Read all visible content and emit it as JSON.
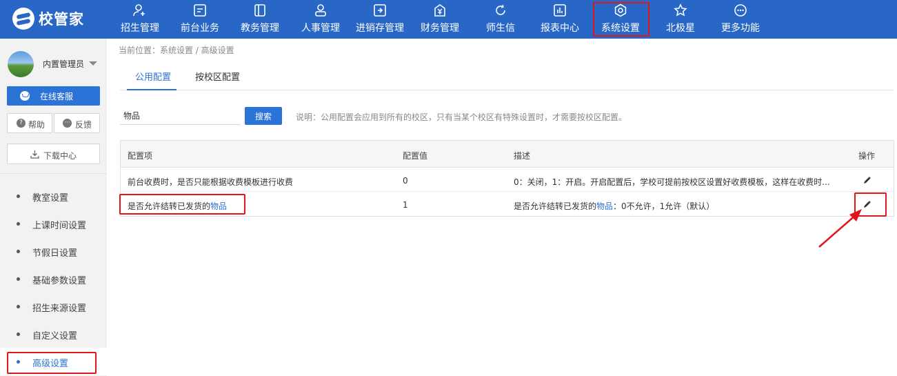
{
  "brand": {
    "name": "校管家"
  },
  "nav": [
    {
      "id": "zhaosheng",
      "label": "招生管理",
      "icon": "person-add-icon"
    },
    {
      "id": "qiantai",
      "label": "前台业务",
      "icon": "screen-icon"
    },
    {
      "id": "jiaowu",
      "label": "教务管理",
      "icon": "book-icon"
    },
    {
      "id": "renshi",
      "label": "人事管理",
      "icon": "person-icon"
    },
    {
      "id": "jinxiaocun",
      "label": "进销存管理",
      "icon": "inbox-icon"
    },
    {
      "id": "caiwu",
      "label": "财务管理",
      "icon": "yen-icon"
    },
    {
      "id": "shishengxin",
      "label": "师生信",
      "icon": "chat-icon"
    },
    {
      "id": "baobiao",
      "label": "报表中心",
      "icon": "report-icon"
    },
    {
      "id": "xitong",
      "label": "系统设置",
      "icon": "settings-icon"
    },
    {
      "id": "beijixing",
      "label": "北极星",
      "icon": "star-icon"
    },
    {
      "id": "gengduo",
      "label": "更多功能",
      "icon": "more-icon"
    }
  ],
  "sidebar": {
    "user_name": "内置管理员",
    "customer_service": "在线客服",
    "help": "帮助",
    "feedback": "反馈",
    "download": "下载中心",
    "menu": [
      {
        "label": "教室设置"
      },
      {
        "label": "上课时间设置"
      },
      {
        "label": "节假日设置"
      },
      {
        "label": "基础参数设置"
      },
      {
        "label": "招生来源设置"
      },
      {
        "label": "自定义设置"
      },
      {
        "label": "高级设置"
      }
    ]
  },
  "breadcrumb": "当前位置：系统设置 / 高级设置",
  "tabs": [
    {
      "label": "公用配置"
    },
    {
      "label": "按校区配置"
    }
  ],
  "search": {
    "value": "物品",
    "button": "搜索",
    "note": "说明：公用配置会应用到所有的校区，只有当某个校区有特殊设置时，才需要按校区配置。"
  },
  "table": {
    "headers": {
      "item": "配置项",
      "value": "配置值",
      "desc": "描述",
      "action": "操作"
    },
    "rows": [
      {
        "item": "前台收费时，是否只能根据收费模板进行收费",
        "value": "0",
        "desc": "0：关闭，1：开启。开启配置后，学校可提前按校区设置好收费模板，这样在收费时..."
      },
      {
        "item_prefix": "是否允许结转已发货的",
        "item_link": "物品",
        "value": "1",
        "desc_prefix": "是否允许结转已发货的",
        "desc_link": "物品",
        "desc_suffix": "：0不允许，1允许（默认）"
      }
    ]
  },
  "colors": {
    "nav_bg": "#2867c6",
    "accent": "#2b73d6",
    "highlight": "#e0161c"
  }
}
